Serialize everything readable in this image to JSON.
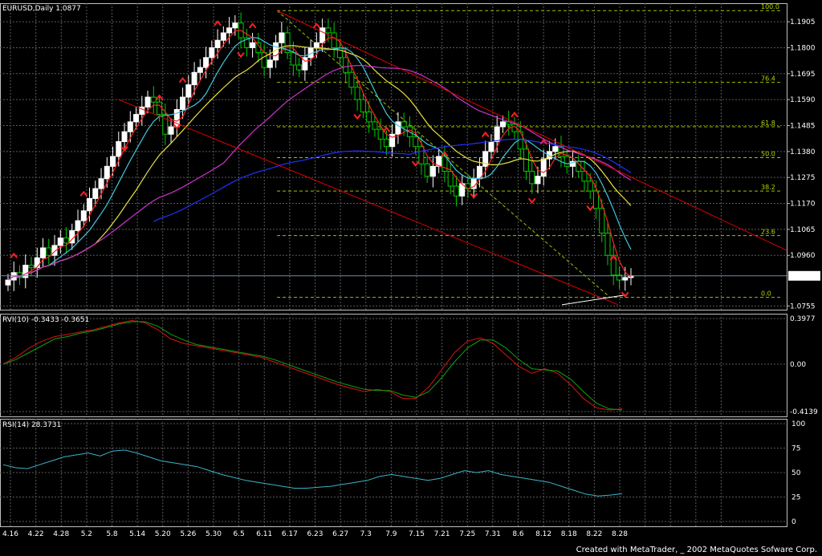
{
  "footer": {
    "credit": "Created with MetaTrader, _ 2002 MetaQuotes Sofware Corp."
  },
  "colors": {
    "background": "#000000",
    "grid": "#5a5a5a",
    "bull": "#ffffff",
    "bear": "#00cc00",
    "ma_red": "#ff2020",
    "ma_cyan": "#40c8e0",
    "ma_yellow": "#e8e040",
    "ma_magenta": "#cc33cc",
    "ma_blue": "#2030ff",
    "channel": "#dd0000",
    "fib": "#a0c000",
    "rvi_main": "#dd1111",
    "rvi_signal": "#10a010",
    "rsi": "#3ab4c8"
  },
  "chart_data": [
    {
      "type": "candlestick",
      "title": "EURUSD,Daily  1.0877",
      "symbol": "EURUSD",
      "timeframe": "Daily",
      "last_price": 1.0877,
      "last_price_label": "1.0877",
      "x_ticks": [
        "4.16",
        "4.22",
        "4.28",
        "5.2",
        "5.8",
        "5.14",
        "5.20",
        "5.26",
        "5.30",
        "6.5",
        "6.11",
        "6.17",
        "6.23",
        "6.27",
        "7.3",
        "7.9",
        "7.15",
        "7.21",
        "7.25",
        "7.31",
        "8.6",
        "8.12",
        "8.18",
        "8.22",
        "8.28"
      ],
      "y_ticks": [
        "1.1905",
        "1.1800",
        "1.1695",
        "1.1590",
        "1.1485",
        "1.1380",
        "1.1275",
        "1.1170",
        "1.1065",
        "1.0960",
        "1.0755"
      ],
      "ylim": [
        1.074,
        1.198
      ],
      "grid": true,
      "close_values": [
        1.086,
        1.089,
        1.087,
        1.092,
        1.091,
        1.095,
        1.099,
        1.096,
        1.1,
        1.103,
        1.101,
        1.106,
        1.11,
        1.114,
        1.119,
        1.123,
        1.127,
        1.132,
        1.136,
        1.142,
        1.146,
        1.15,
        1.153,
        1.156,
        1.16,
        1.158,
        1.153,
        1.145,
        1.148,
        1.155,
        1.16,
        1.165,
        1.17,
        1.172,
        1.176,
        1.18,
        1.183,
        1.186,
        1.188,
        1.19,
        1.184,
        1.18,
        1.182,
        1.178,
        1.172,
        1.175,
        1.182,
        1.186,
        1.178,
        1.173,
        1.171,
        1.176,
        1.18,
        1.182,
        1.188,
        1.186,
        1.18,
        1.176,
        1.17,
        1.164,
        1.159,
        1.154,
        1.15,
        1.147,
        1.143,
        1.14,
        1.145,
        1.15,
        1.148,
        1.144,
        1.14,
        1.133,
        1.128,
        1.132,
        1.136,
        1.13,
        1.124,
        1.12,
        1.125,
        1.123,
        1.127,
        1.132,
        1.138,
        1.142,
        1.148,
        1.15,
        1.149,
        1.146,
        1.139,
        1.13,
        1.125,
        1.128,
        1.135,
        1.138,
        1.14,
        1.136,
        1.132,
        1.134,
        1.13,
        1.126,
        1.122,
        1.115,
        1.105,
        1.096,
        1.088,
        1.086,
        1.087,
        1.0877
      ],
      "fibonacci_levels": [
        {
          "label": "100.0",
          "price": 1.195
        },
        {
          "label": "76.4",
          "price": 1.166
        },
        {
          "label": "61.8",
          "price": 1.148
        },
        {
          "label": "50.0",
          "price": 1.1355
        },
        {
          "label": "38.2",
          "price": 1.122
        },
        {
          "label": "23.6",
          "price": 1.104
        },
        {
          "label": "0.0",
          "price": 1.079
        }
      ]
    },
    {
      "type": "line",
      "title": "RVI(10)  -0.3433  -0.3651",
      "indicator": "RVI",
      "period": 10,
      "current_values": [
        -0.3433,
        -0.3651
      ],
      "y_ticks": [
        "0.3977",
        "0.00",
        "-0.4139"
      ],
      "ylim": [
        -0.4139,
        0.3977
      ],
      "series": [
        {
          "values": [
            0.0,
            0.06,
            0.14,
            0.2,
            0.24,
            0.26,
            0.28,
            0.3,
            0.33,
            0.36,
            0.38,
            0.36,
            0.3,
            0.22,
            0.18,
            0.16,
            0.14,
            0.12,
            0.1,
            0.08,
            0.06,
            0.02,
            -0.02,
            -0.06,
            -0.1,
            -0.14,
            -0.18,
            -0.21,
            -0.24,
            -0.22,
            -0.24,
            -0.3,
            -0.3,
            -0.2,
            -0.05,
            0.1,
            0.2,
            0.23,
            0.18,
            0.08,
            -0.02,
            -0.08,
            -0.04,
            -0.08,
            -0.18,
            -0.3,
            -0.38,
            -0.4,
            -0.39
          ]
        },
        {
          "values": [
            0.0,
            0.04,
            0.1,
            0.16,
            0.22,
            0.24,
            0.27,
            0.29,
            0.32,
            0.35,
            0.37,
            0.37,
            0.33,
            0.26,
            0.21,
            0.17,
            0.15,
            0.13,
            0.11,
            0.09,
            0.07,
            0.04,
            0.0,
            -0.04,
            -0.08,
            -0.12,
            -0.16,
            -0.19,
            -0.22,
            -0.23,
            -0.23,
            -0.27,
            -0.29,
            -0.24,
            -0.12,
            0.02,
            0.14,
            0.21,
            0.21,
            0.14,
            0.04,
            -0.04,
            -0.05,
            -0.06,
            -0.13,
            -0.24,
            -0.34,
            -0.39,
            -0.4
          ]
        }
      ]
    },
    {
      "type": "line",
      "title": "RSI(14)  28.3731",
      "indicator": "RSI",
      "period": 14,
      "current_value": 28.3731,
      "y_ticks": [
        "100",
        "75",
        "50",
        "25",
        "0"
      ],
      "ylim": [
        0,
        100
      ],
      "series": [
        {
          "values": [
            58,
            55,
            54,
            58,
            62,
            66,
            68,
            70,
            67,
            72,
            73,
            70,
            66,
            62,
            60,
            58,
            56,
            52,
            48,
            45,
            42,
            40,
            38,
            36,
            34,
            34,
            35,
            36,
            38,
            40,
            42,
            46,
            48,
            46,
            44,
            42,
            44,
            48,
            52,
            50,
            52,
            48,
            46,
            44,
            42,
            40,
            36,
            32,
            28,
            26,
            27,
            28.37
          ]
        }
      ]
    }
  ]
}
